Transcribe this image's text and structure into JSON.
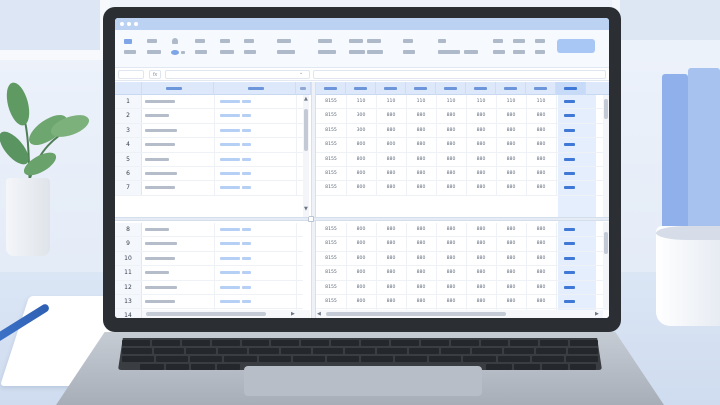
{
  "app": {
    "formula_fx": "fx",
    "accent": "#3f78d6",
    "header_bg": "#dde9fa"
  },
  "rows": [
    {
      "n": "1",
      "v": [
        "8155",
        "110",
        "110",
        "110",
        "110",
        "110",
        "110",
        "110"
      ]
    },
    {
      "n": "2",
      "v": [
        "8155",
        "300",
        "880",
        "880",
        "880",
        "880",
        "880",
        "880"
      ]
    },
    {
      "n": "3",
      "v": [
        "8155",
        "300",
        "880",
        "880",
        "880",
        "880",
        "880",
        "880"
      ]
    },
    {
      "n": "4",
      "v": [
        "8155",
        "800",
        "800",
        "880",
        "880",
        "880",
        "880",
        "880"
      ]
    },
    {
      "n": "5",
      "v": [
        "8155",
        "800",
        "880",
        "880",
        "880",
        "880",
        "880",
        "880"
      ]
    },
    {
      "n": "6",
      "v": [
        "8155",
        "800",
        "880",
        "880",
        "880",
        "880",
        "880",
        "880"
      ]
    },
    {
      "n": "7",
      "v": [
        "8155",
        "800",
        "880",
        "880",
        "880",
        "880",
        "880",
        "880"
      ]
    },
    {
      "n": "8",
      "v": [
        "8155",
        "800",
        "880",
        "880",
        "880",
        "880",
        "880",
        "880"
      ]
    },
    {
      "n": "9",
      "v": [
        "8155",
        "800",
        "880",
        "880",
        "880",
        "880",
        "880",
        "880"
      ]
    },
    {
      "n": "10",
      "v": [
        "8155",
        "800",
        "880",
        "880",
        "880",
        "880",
        "880",
        "880"
      ]
    },
    {
      "n": "11",
      "v": [
        "8155",
        "800",
        "880",
        "880",
        "880",
        "880",
        "880",
        "880"
      ]
    },
    {
      "n": "12",
      "v": [
        "8155",
        "800",
        "880",
        "880",
        "880",
        "880",
        "880",
        "880"
      ]
    },
    {
      "n": "13",
      "v": [
        "8155",
        "800",
        "880",
        "880",
        "880",
        "880",
        "880",
        "880"
      ]
    },
    {
      "n": "14",
      "v": [
        "8155",
        "700",
        "790",
        "880",
        "880",
        "880",
        "880",
        "880"
      ]
    }
  ],
  "icons": {
    "scroll_up": "▲",
    "scroll_down": "▼",
    "scroll_left": "◀",
    "scroll_right": "▶",
    "dropdown": "⌄"
  }
}
